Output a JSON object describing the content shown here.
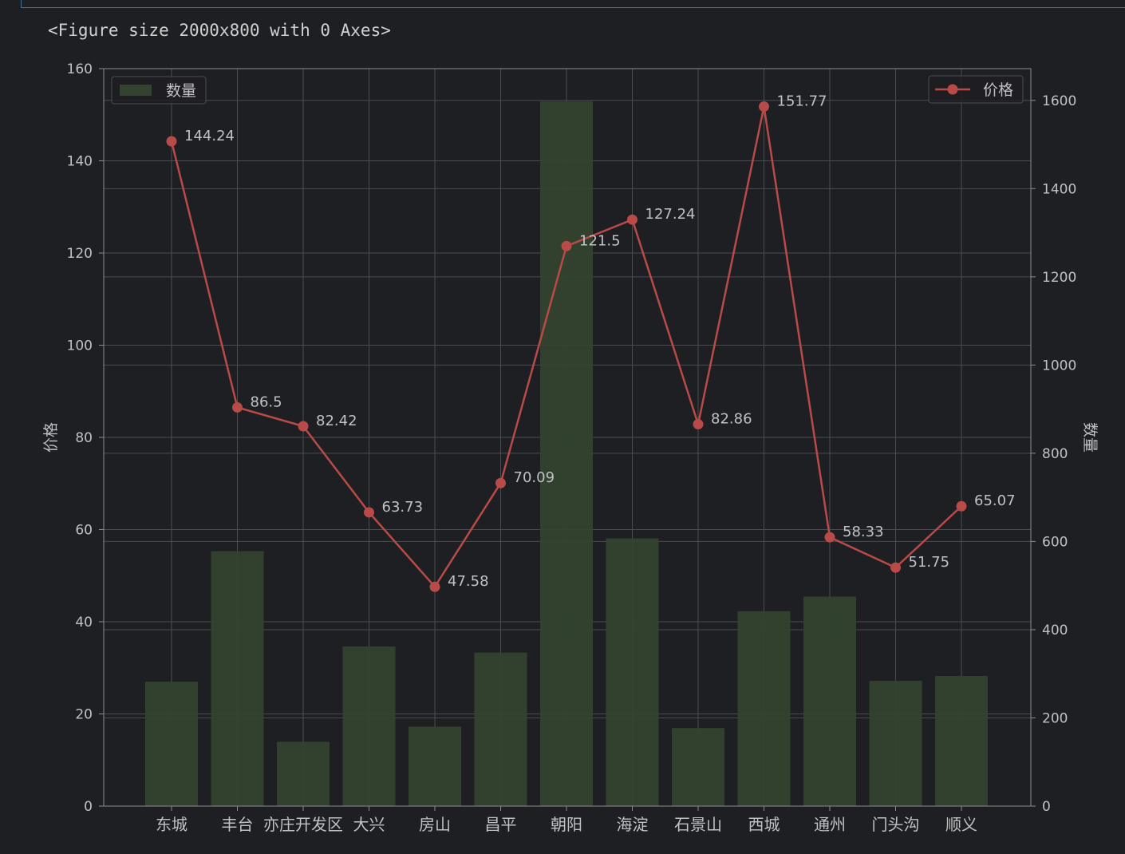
{
  "output_text": "<Figure size 2000x800 with 0 Axes>",
  "colors": {
    "background": "#1e1f22",
    "grid": "#4a4c50",
    "axis": "#8a8c90",
    "text": "#bfc1c4",
    "bar": "#33432f",
    "line": "#b84a48"
  },
  "chart_data": {
    "type": "bar+line",
    "categories": [
      "东城",
      "丰台",
      "亦庄开发区",
      "大兴",
      "房山",
      "昌平",
      "朝阳",
      "海淀",
      "石景山",
      "西城",
      "通州",
      "门头沟",
      "顺义"
    ],
    "bar_series": {
      "name": "数量",
      "axis": "right",
      "values": [
        282,
        578,
        146,
        362,
        180,
        348,
        1598,
        607,
        177,
        442,
        475,
        284,
        295
      ]
    },
    "line_series": {
      "name": "价格",
      "axis": "left",
      "marker": "circle",
      "values": [
        144.24,
        86.5,
        82.42,
        63.73,
        47.58,
        70.09,
        121.5,
        127.24,
        82.86,
        151.77,
        58.33,
        51.75,
        65.07
      ],
      "labels": [
        "144.24",
        "86.5",
        "82.42",
        "63.73",
        "47.58",
        "70.09",
        "121.5",
        "127.24",
        "82.86",
        "151.77",
        "58.33",
        "51.75",
        "65.07"
      ]
    },
    "ylabel_left": "价格",
    "ylabel_right": "数量",
    "ylim_left": [
      0,
      160
    ],
    "ylim_right": [
      0,
      1672
    ],
    "yticks_left": [
      0,
      20,
      40,
      60,
      80,
      100,
      120,
      140,
      160
    ],
    "yticks_right": [
      0,
      200,
      400,
      600,
      800,
      1000,
      1200,
      1400,
      1600
    ],
    "legend_left": {
      "label": "数量",
      "placement": "top-left"
    },
    "legend_right": {
      "label": "价格",
      "placement": "top-right"
    },
    "grid": true
  }
}
